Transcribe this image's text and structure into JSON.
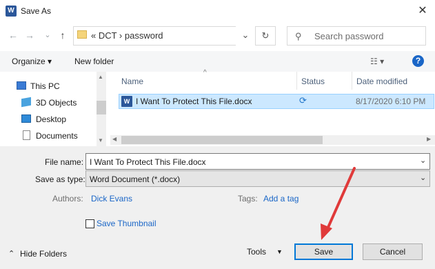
{
  "window": {
    "title": "Save As",
    "app_icon": "W",
    "close_icon": "close-icon"
  },
  "nav": {
    "back": "←",
    "forward": "→",
    "history": "⌄",
    "up": "↑",
    "breadcrumb": "«  DCT  ›  password",
    "dropdown_glyph": "⌄",
    "refresh": "↻"
  },
  "search": {
    "icon": "⚲",
    "placeholder": "Search password"
  },
  "toolbar": {
    "organize": "Organize ▾",
    "new_folder": "New folder",
    "view": "☷ ▾",
    "help": "?"
  },
  "sidebar": {
    "items": [
      {
        "label": "This PC",
        "icon": "computer-icon"
      },
      {
        "label": "3D Objects",
        "icon": "cube-icon"
      },
      {
        "label": "Desktop",
        "icon": "desktop-icon"
      },
      {
        "label": "Documents",
        "icon": "documents-icon"
      }
    ]
  },
  "file_list": {
    "columns": [
      "Name",
      "Status",
      "Date modified"
    ],
    "sort_arrow": "^",
    "rows": [
      {
        "name": "I Want To Protect This File.docx",
        "status_icon": "sync-icon",
        "status_glyph": "⟳",
        "date": "8/17/2020 6:10 PM",
        "type_icon": "W"
      }
    ]
  },
  "form": {
    "file_name_label": "File name:",
    "file_name_value": "I Want To Protect This File.docx",
    "save_type_label": "Save as type:",
    "save_type_value": "Word Document (*.docx)",
    "authors_label": "Authors:",
    "authors_value": "Dick Evans",
    "tags_label": "Tags:",
    "tags_value": "Add a tag",
    "thumbnail_label": "Save Thumbnail"
  },
  "footer": {
    "hide_folders": "Hide Folders",
    "hide_glyph": "⌃",
    "tools": "Tools",
    "tools_glyph": "▼",
    "save": "Save",
    "cancel": "Cancel"
  },
  "colors": {
    "accent": "#0078d7",
    "selection": "#cce8ff",
    "arrow": "#e03a3a"
  }
}
